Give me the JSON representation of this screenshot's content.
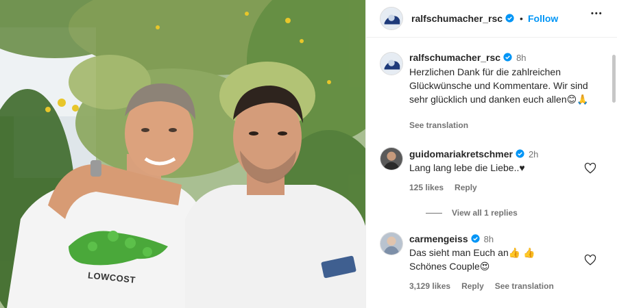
{
  "post": {
    "image_description_icon": "post-photo",
    "shirt_text": "LOWCOST"
  },
  "header": {
    "username": "ralfschumacher_rsc",
    "separator": "•",
    "follow_label": "Follow",
    "more_label": "•••"
  },
  "caption": {
    "username": "ralfschumacher_rsc",
    "time": "8h",
    "text": "Herzlichen Dank für die zahlreichen Glückwünsche und Kommentare. Wir sind sehr glücklich und danken euch allen😊🙏",
    "see_translation": "See translation"
  },
  "comments": [
    {
      "username": "guidomariakretschmer",
      "time": "2h",
      "text": "Lang lang lebe die Liebe..♥",
      "likes": "125 likes",
      "reply": "Reply",
      "view_replies": "View all 1 replies"
    },
    {
      "username": "carmengeiss",
      "time": "8h",
      "text_line1": "Das sieht man Euch an👍 👍",
      "text_line2": "Schönes Couple😍",
      "likes": "3,129 likes",
      "reply": "Reply",
      "see_translation": "See translation"
    }
  ],
  "colors": {
    "link_blue": "#0095f6",
    "verified_blue": "#0095f6",
    "muted": "#737373"
  }
}
